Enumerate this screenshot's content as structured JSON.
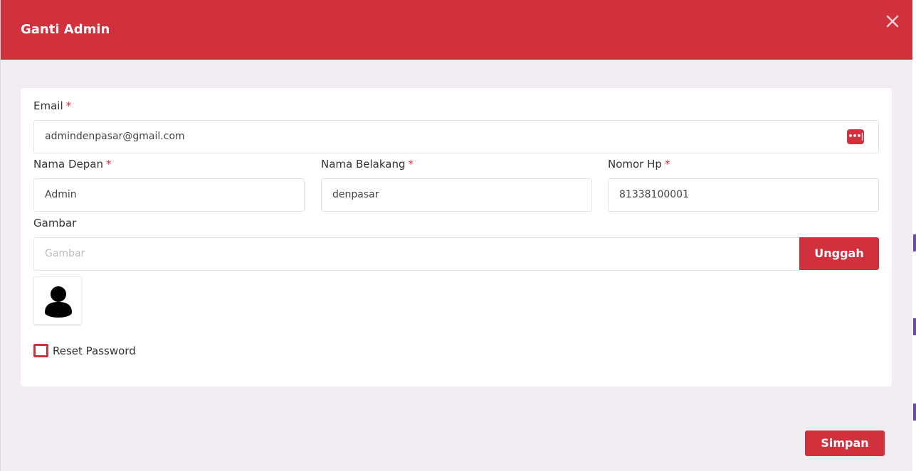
{
  "modal": {
    "title": "Ganti Admin",
    "close_icon": "close-icon"
  },
  "form": {
    "email": {
      "label": "Email",
      "required": "*",
      "value": "admindenpasar@gmail.com",
      "icon": "password-dots-icon"
    },
    "first_name": {
      "label": "Nama Depan",
      "required": "*",
      "value": "Admin"
    },
    "last_name": {
      "label": "Nama Belakang",
      "required": "*",
      "value": "denpasar"
    },
    "phone": {
      "label": "Nomor Hp",
      "required": "*",
      "value": "81338100001"
    },
    "image": {
      "label": "Gambar",
      "placeholder": "Gambar",
      "upload_label": "Unggah",
      "avatar_icon": "user-avatar-icon"
    },
    "reset_password": {
      "label": "Reset Password",
      "checked": false
    }
  },
  "footer": {
    "save_label": "Simpan"
  },
  "colors": {
    "accent": "#d1303d",
    "modal_background": "#f1edf2",
    "card_background": "#ffffff"
  }
}
